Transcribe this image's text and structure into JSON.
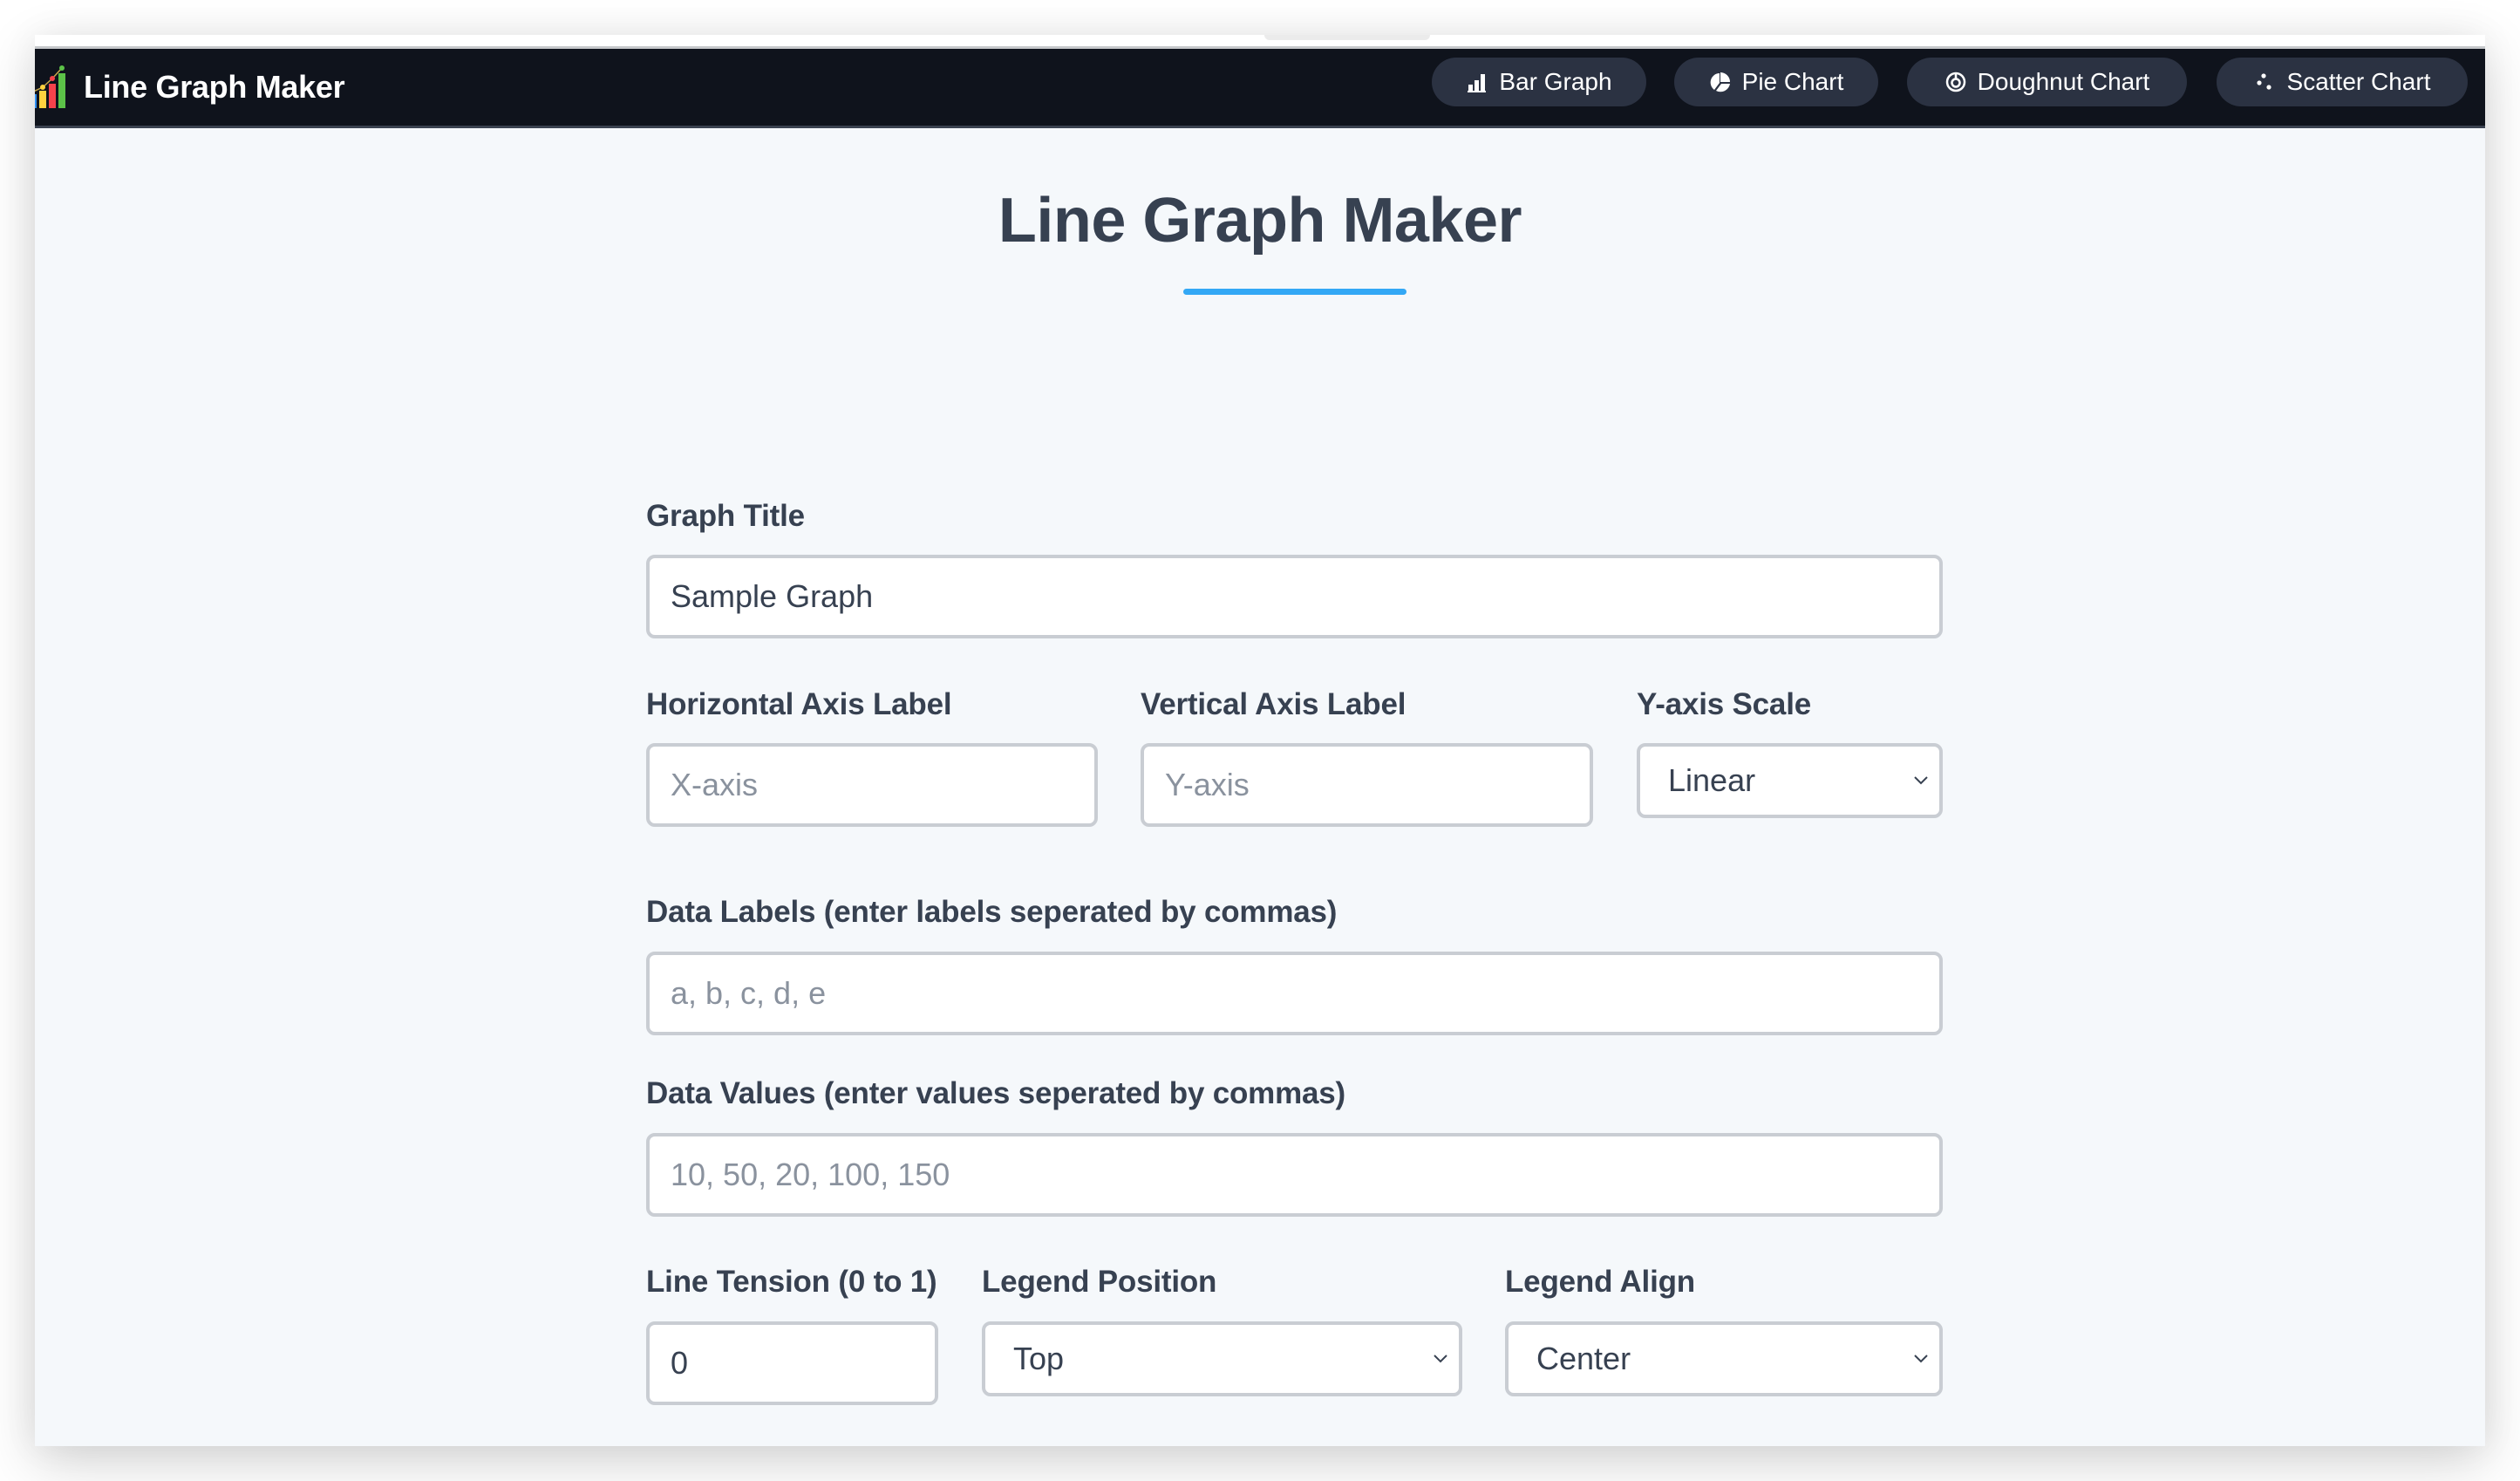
{
  "app": {
    "brand_title": "Line Graph Maker",
    "logo_icon": "bar-line-chart-logo"
  },
  "nav": {
    "buttons": [
      {
        "label": "Bar Graph",
        "icon": "bar-chart-icon"
      },
      {
        "label": "Pie Chart",
        "icon": "pie-chart-icon"
      },
      {
        "label": "Doughnut Chart",
        "icon": "doughnut-chart-icon"
      },
      {
        "label": "Scatter Chart",
        "icon": "scatter-chart-icon"
      }
    ]
  },
  "page": {
    "title": "Line Graph Maker",
    "accent_color": "#33a8f5"
  },
  "form": {
    "graph_title": {
      "label": "Graph Title",
      "value": "Sample Graph",
      "placeholder": ""
    },
    "x_axis": {
      "label": "Horizontal Axis Label",
      "value": "",
      "placeholder": "X-axis"
    },
    "y_axis": {
      "label": "Vertical Axis Label",
      "value": "",
      "placeholder": "Y-axis"
    },
    "y_scale": {
      "label": "Y-axis Scale",
      "selected": "Linear"
    },
    "data_labels": {
      "label": "Data Labels (enter labels seperated by commas)",
      "value": "",
      "placeholder": "a, b, c, d, e"
    },
    "data_values": {
      "label": "Data Values (enter values seperated by commas)",
      "value": "",
      "placeholder": "10, 50, 20, 100, 150"
    },
    "line_tension": {
      "label": "Line Tension (0 to 1)",
      "value": "0"
    },
    "legend_position": {
      "label": "Legend Position",
      "selected": "Top"
    },
    "legend_align": {
      "label": "Legend Align",
      "selected": "Center"
    }
  }
}
